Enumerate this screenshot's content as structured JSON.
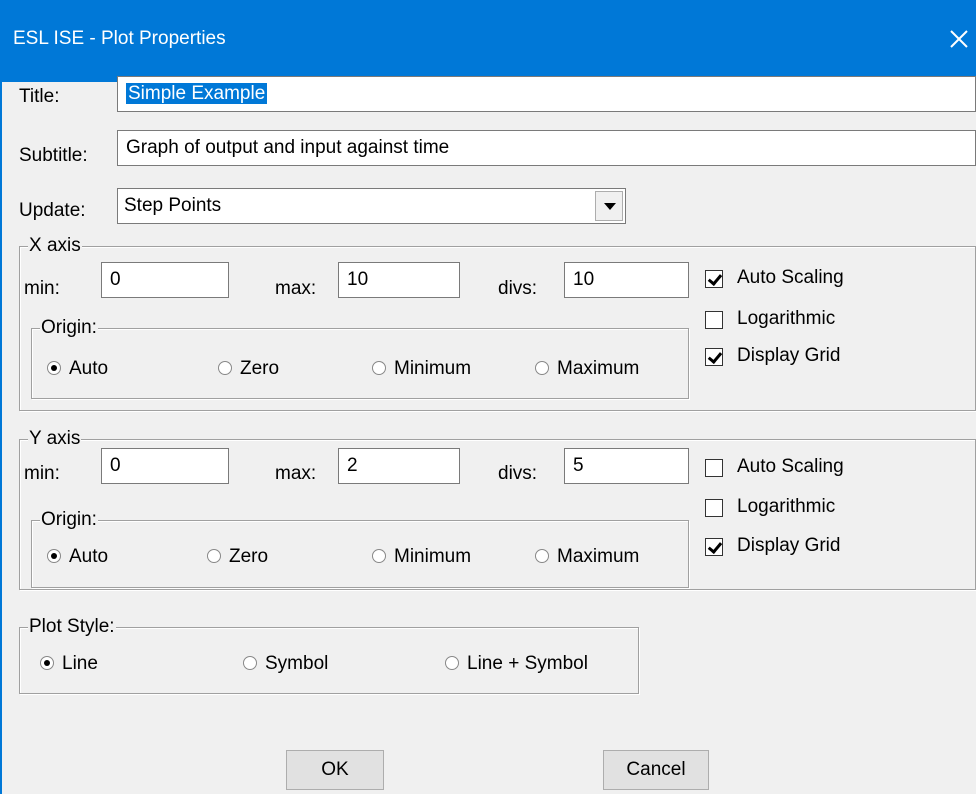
{
  "window": {
    "title": "ESL ISE - Plot Properties",
    "close_icon": "close-icon"
  },
  "form": {
    "title_label": "Title:",
    "title_value": "Simple Example",
    "subtitle_label": "Subtitle:",
    "subtitle_value": "Graph of output and input against time",
    "update_label": "Update:",
    "update_value": "Step Points"
  },
  "x_axis": {
    "legend": "X axis",
    "min_label": "min:",
    "min": "0",
    "max_label": "max:",
    "max": "10",
    "divs_label": "divs:",
    "divs": "10",
    "origin_legend": "Origin:",
    "origin_options": [
      "Auto",
      "Zero",
      "Minimum",
      "Maximum"
    ],
    "origin_selected": "Auto",
    "auto_scaling_label": "Auto Scaling",
    "auto_scaling": true,
    "logarithmic_label": "Logarithmic",
    "logarithmic": false,
    "display_grid_label": "Display Grid",
    "display_grid": true
  },
  "y_axis": {
    "legend": "Y axis",
    "min_label": "min:",
    "min": "0",
    "max_label": "max:",
    "max": "2",
    "divs_label": "divs:",
    "divs": "5",
    "origin_legend": "Origin:",
    "origin_options": [
      "Auto",
      "Zero",
      "Minimum",
      "Maximum"
    ],
    "origin_selected": "Auto",
    "auto_scaling_label": "Auto Scaling",
    "auto_scaling": false,
    "logarithmic_label": "Logarithmic",
    "logarithmic": false,
    "display_grid_label": "Display Grid",
    "display_grid": true
  },
  "plot_style": {
    "legend": "Plot Style:",
    "options": [
      "Line",
      "Symbol",
      "Line + Symbol"
    ],
    "selected": "Line"
  },
  "buttons": {
    "ok": "OK",
    "cancel": "Cancel"
  },
  "colors": {
    "titlebar": "#0078d7",
    "selection": "#0078d7",
    "dialog_bg": "#f0f0f0"
  }
}
